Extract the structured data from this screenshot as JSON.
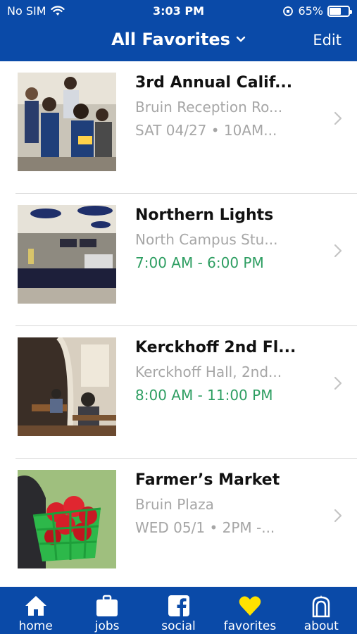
{
  "status_bar": {
    "carrier": "No SIM",
    "time": "3:03 PM",
    "battery": "65%",
    "battery_level": 0.65
  },
  "nav": {
    "title": "All Favorites",
    "edit_label": "Edit"
  },
  "colors": {
    "brand": "#0a4aa8",
    "green": "#2e9e62",
    "gray": "#a6a6a6",
    "yellow": "#ffe200"
  },
  "favorites": [
    {
      "title": "3rd Annual Calif...",
      "subtitle": "Bruin Reception Ro...",
      "detail": "SAT 04/27 • 10AM...",
      "detail_color": "#a6a6a6"
    },
    {
      "title": "Northern Lights",
      "subtitle": "North Campus Stu...",
      "detail": "7:00 AM - 6:00 PM",
      "detail_color": "#2e9e62"
    },
    {
      "title": "Kerckhoff 2nd Fl...",
      "subtitle": "Kerckhoff Hall, 2nd...",
      "detail": "8:00 AM - 11:00 PM",
      "detail_color": "#2e9e62"
    },
    {
      "title": "Farmer’s Market",
      "subtitle": "Bruin Plaza",
      "detail": "WED 05/1 • 2PM -...",
      "detail_color": "#a6a6a6"
    }
  ],
  "tabs": [
    {
      "label": "home",
      "icon": "home-icon"
    },
    {
      "label": "jobs",
      "icon": "briefcase-icon"
    },
    {
      "label": "social",
      "icon": "facebook-icon"
    },
    {
      "label": "favorites",
      "icon": "heart-icon"
    },
    {
      "label": "about",
      "icon": "tower-icon"
    }
  ]
}
